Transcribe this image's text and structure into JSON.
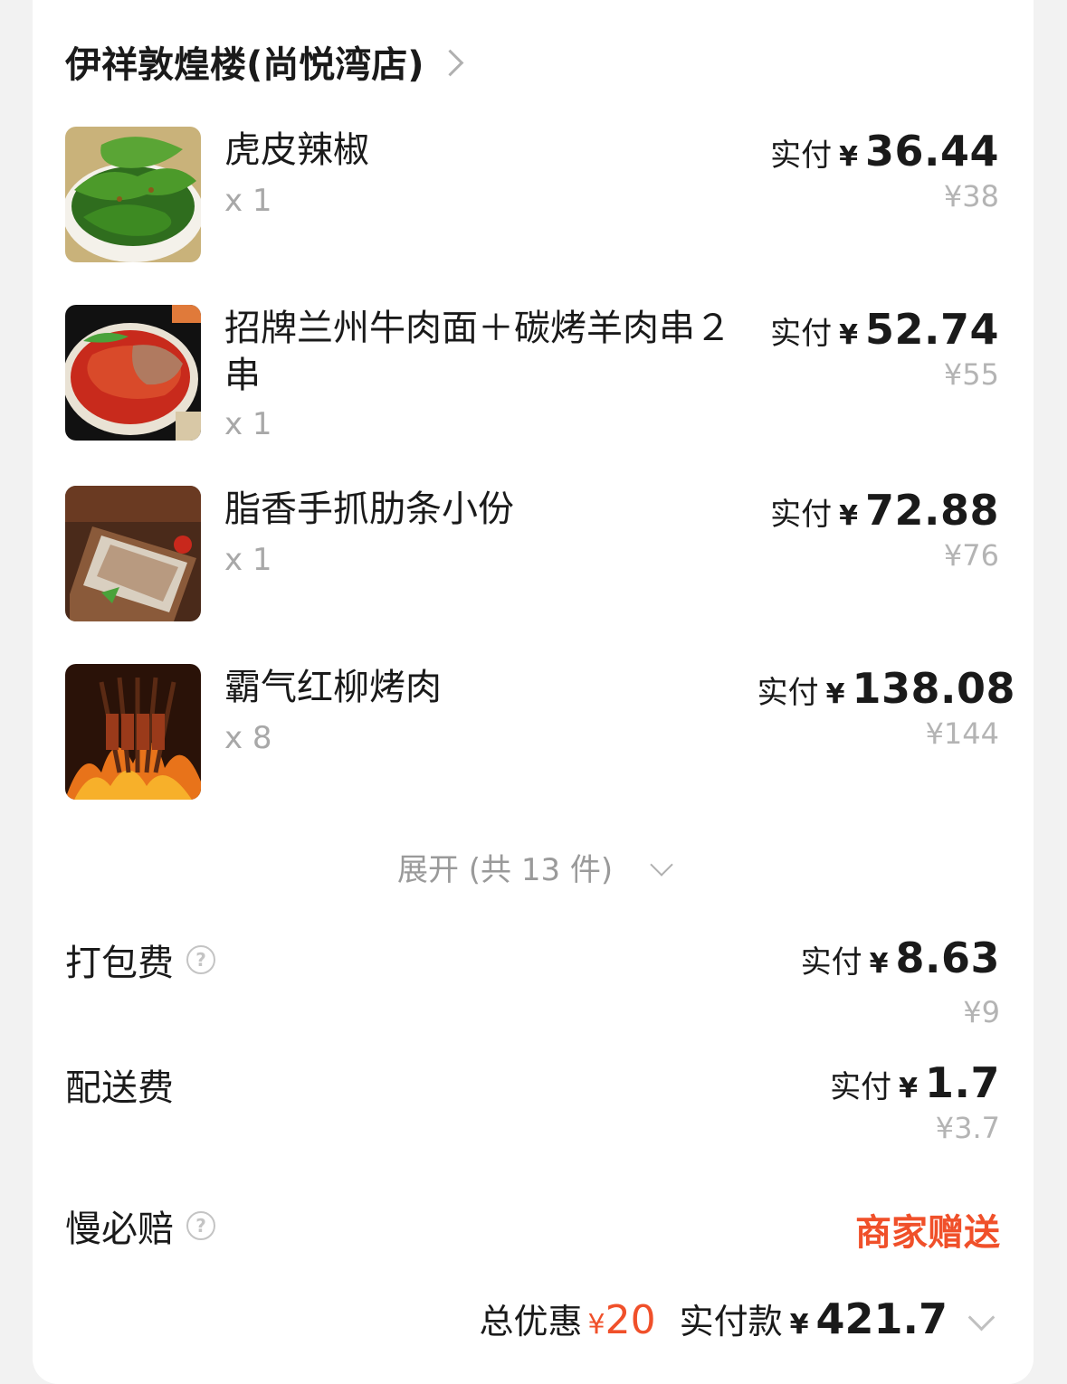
{
  "shop": {
    "name": "伊祥敦煌楼(尚悦湾店)"
  },
  "items": [
    {
      "name": "虎皮辣椒",
      "qty": "x 1",
      "paid_label": "实付",
      "currency": "¥",
      "paid": "36.44",
      "original": "¥38",
      "thumb": "green-pepper-dish"
    },
    {
      "name": "招牌兰州牛肉面＋碳烤羊肉串２串",
      "qty": "x 1",
      "paid_label": "实付",
      "currency": "¥",
      "paid": "52.74",
      "original": "¥55",
      "thumb": "beef-noodle-bowl"
    },
    {
      "name": "脂香手抓肋条小份",
      "qty": "x 1",
      "paid_label": "实付",
      "currency": "¥",
      "paid": "72.88",
      "original": "¥76",
      "thumb": "lamb-ribs-plate"
    },
    {
      "name": "霸气红柳烤肉",
      "qty": "x 8",
      "paid_label": "实付",
      "currency": "¥",
      "paid": "138.08",
      "original": "¥144",
      "thumb": "grilled-skewers"
    }
  ],
  "expand": {
    "label": "展开 (共 13 件)"
  },
  "fees": {
    "packing": {
      "label": "打包费",
      "paid_label": "实付",
      "currency": "¥",
      "paid": "8.63",
      "original": "¥9"
    },
    "delivery": {
      "label": "配送费",
      "paid_label": "实付",
      "currency": "¥",
      "paid": "1.7",
      "original": "¥3.7"
    },
    "late_guarantee": {
      "label": "慢必赔",
      "value": "商家赠送"
    }
  },
  "summary": {
    "discount_label": "总优惠",
    "discount_currency": "¥",
    "discount": "20",
    "total_label": "实付款",
    "total_currency": "¥",
    "total": "421.7"
  },
  "colors": {
    "accent_red": "#f0502a",
    "muted": "#b4b4b4"
  }
}
